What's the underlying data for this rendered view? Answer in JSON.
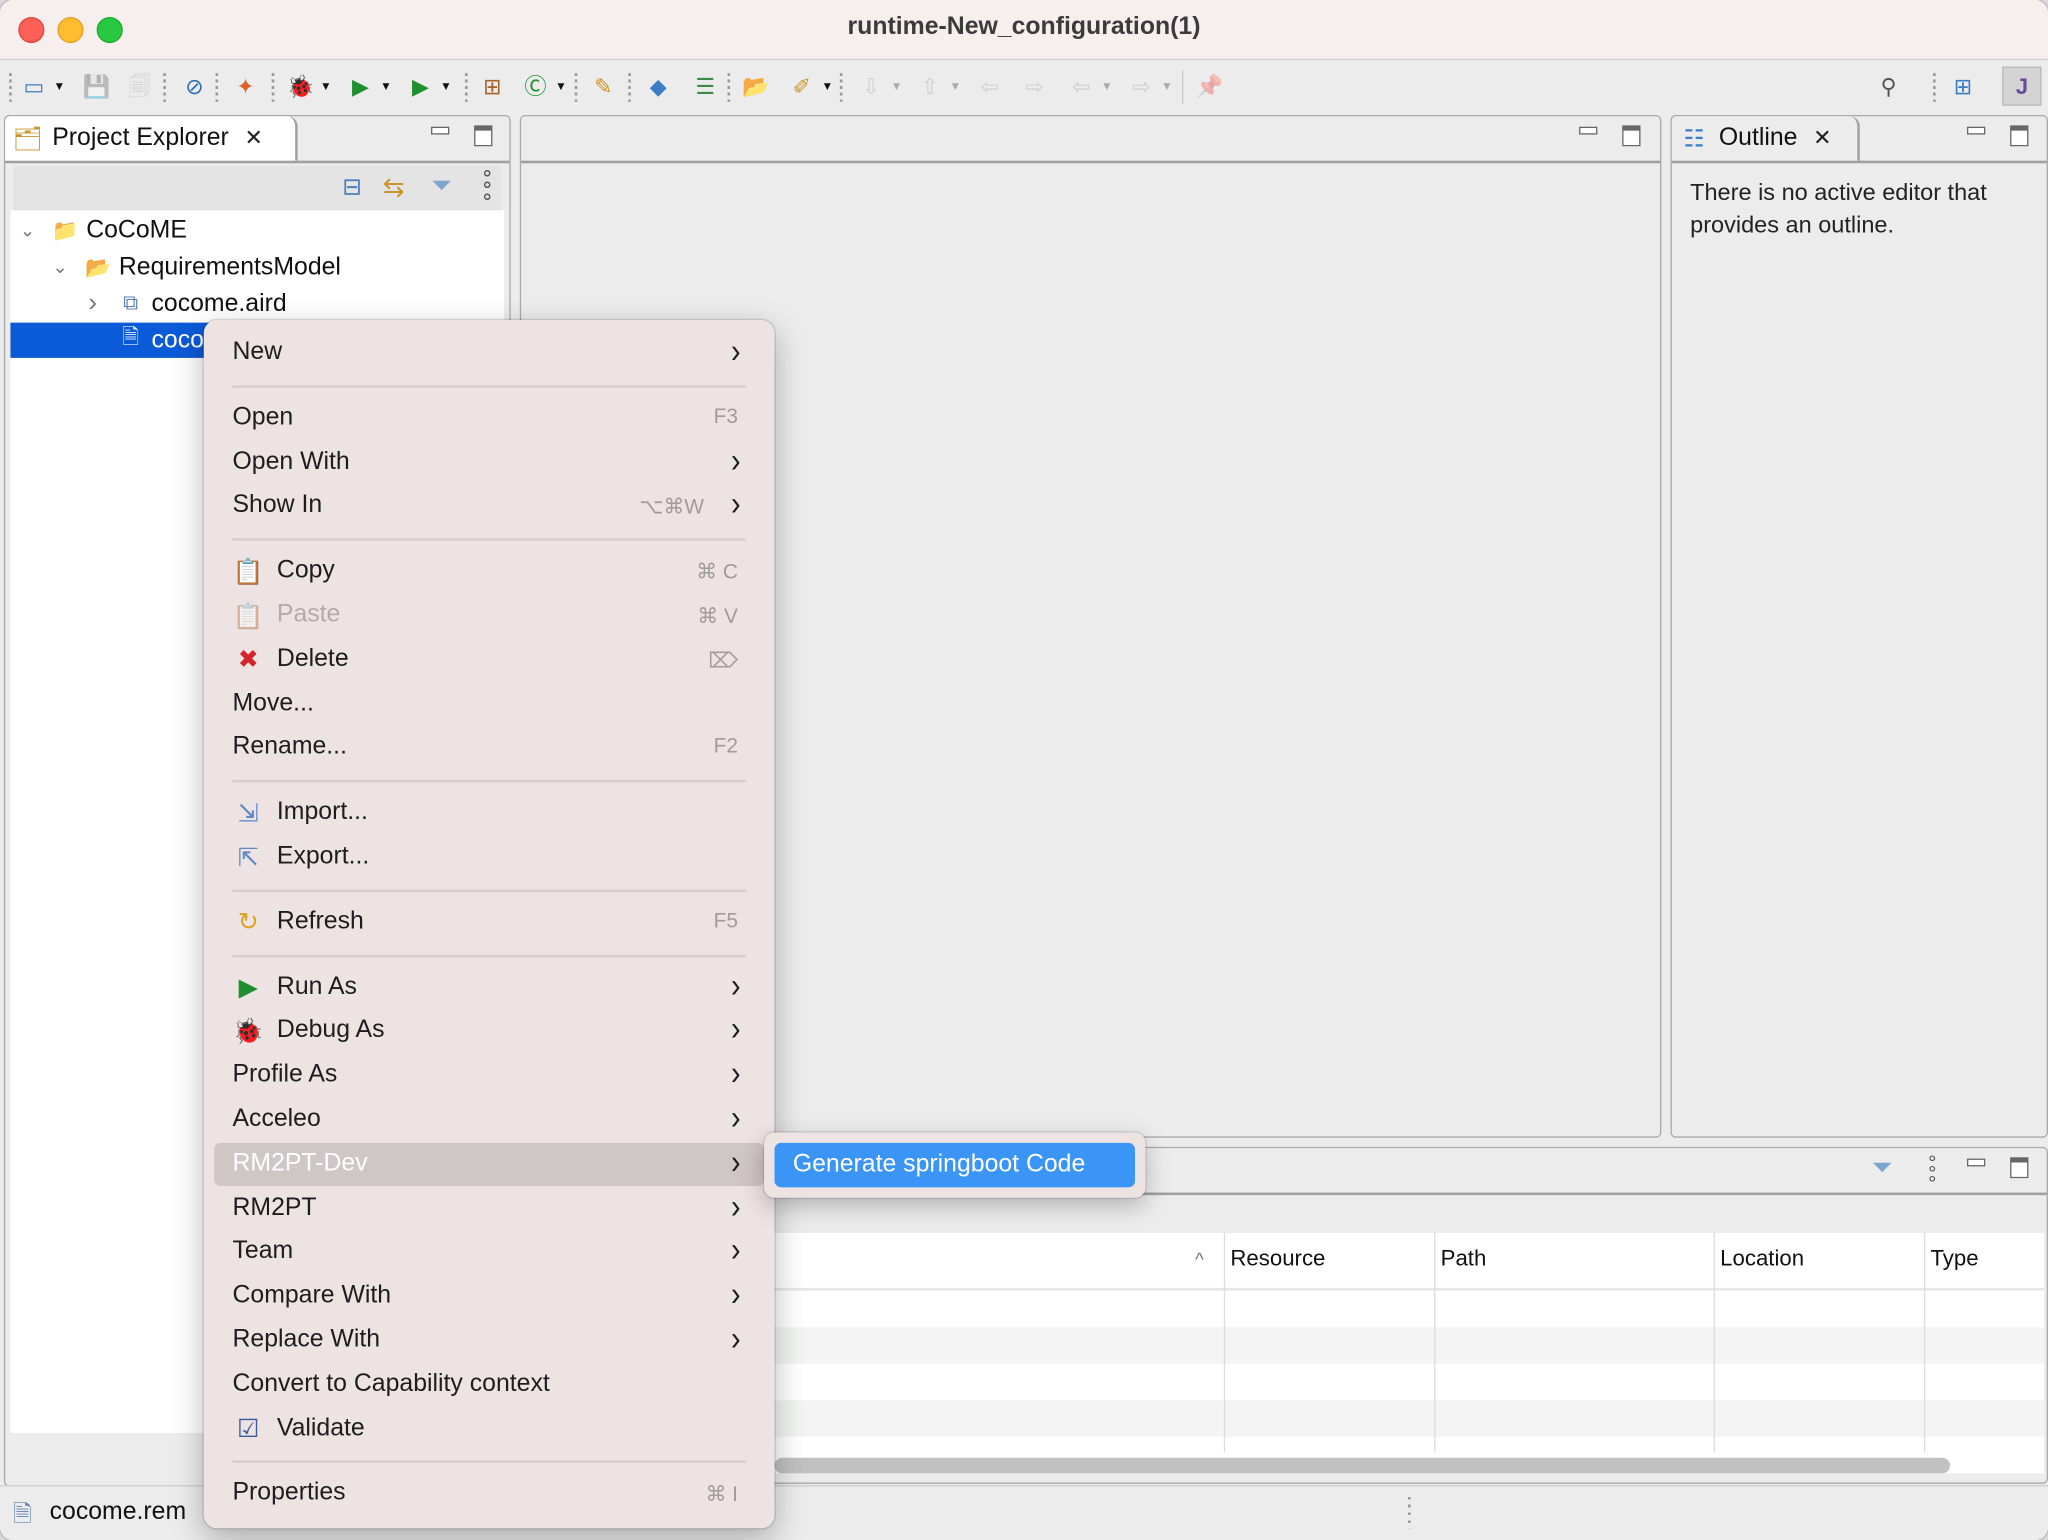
{
  "window": {
    "title": "runtime-New_configuration(1)"
  },
  "toolbar": {
    "items": [
      {
        "icon": "new-wizard-icon",
        "glyph": "▭",
        "dropdown": true,
        "disabled": false
      },
      {
        "icon": "save-icon",
        "glyph": "💾",
        "dropdown": false,
        "disabled": true
      },
      {
        "icon": "save-all-icon",
        "glyph": "🗐",
        "dropdown": false,
        "disabled": true
      },
      {
        "icon": "skip-breakpoints-icon",
        "glyph": "⊘",
        "dropdown": false,
        "disabled": false
      },
      {
        "icon": "new-model-icon",
        "glyph": "✦",
        "dropdown": false,
        "disabled": false
      },
      {
        "icon": "debug-icon",
        "glyph": "🐞",
        "dropdown": true,
        "disabled": false
      },
      {
        "icon": "run-icon",
        "glyph": "▶",
        "dropdown": true,
        "disabled": false
      },
      {
        "icon": "run-external-tools-icon",
        "glyph": "▶",
        "dropdown": true,
        "disabled": false
      },
      {
        "icon": "new-package-icon",
        "glyph": "⊞",
        "dropdown": false,
        "disabled": false
      },
      {
        "icon": "new-class-icon",
        "glyph": "Ⓒ",
        "dropdown": true,
        "disabled": false
      },
      {
        "icon": "open-task-icon",
        "glyph": "✎",
        "dropdown": false,
        "disabled": false
      },
      {
        "icon": "open-type-icon",
        "glyph": "◆",
        "dropdown": false,
        "disabled": false
      },
      {
        "icon": "open-outline-icon",
        "glyph": "☰",
        "dropdown": false,
        "disabled": false
      },
      {
        "icon": "open-folder-icon",
        "glyph": "📂",
        "dropdown": false,
        "disabled": false
      },
      {
        "icon": "annotation-pen-icon",
        "glyph": "✐",
        "dropdown": true,
        "disabled": false
      },
      {
        "icon": "next-annotation-icon",
        "glyph": "⇩",
        "dropdown": true,
        "disabled": true
      },
      {
        "icon": "previous-annotation-icon",
        "glyph": "⇧",
        "dropdown": true,
        "disabled": true
      },
      {
        "icon": "last-edit-icon",
        "glyph": "⇦",
        "dropdown": false,
        "disabled": true
      },
      {
        "icon": "next-edit-icon",
        "glyph": "⇨",
        "dropdown": false,
        "disabled": true
      },
      {
        "icon": "back-icon",
        "glyph": "⇦",
        "dropdown": true,
        "disabled": true
      },
      {
        "icon": "forward-icon",
        "glyph": "⇨",
        "dropdown": true,
        "disabled": true
      },
      {
        "icon": "pin-editor-icon",
        "glyph": "📌",
        "dropdown": false,
        "disabled": true
      }
    ],
    "right": [
      {
        "icon": "search-icon",
        "glyph": "⚲"
      },
      {
        "icon": "open-perspective-icon",
        "glyph": "⊞"
      },
      {
        "icon": "java-perspective-icon",
        "glyph": "J"
      }
    ]
  },
  "project_explorer": {
    "tab_label": "Project Explorer",
    "tree": [
      {
        "label": "CoCoME",
        "level": 0,
        "expanded": true,
        "icon": "project-icon"
      },
      {
        "label": "RequirementsModel",
        "level": 1,
        "expanded": true,
        "icon": "folder-icon"
      },
      {
        "label": "cocome.aird",
        "level": 2,
        "expanded": false,
        "icon": "aird-file-icon"
      },
      {
        "label": "coco",
        "level": 2,
        "selected": true,
        "icon": "file-icon"
      }
    ],
    "status_file": "cocome.rem"
  },
  "outline": {
    "tab_label": "Outline",
    "message": "There is no active editor that provides an outline."
  },
  "context_menu": {
    "items": [
      {
        "type": "item",
        "label": "New",
        "submenu": true
      },
      {
        "type": "sep"
      },
      {
        "type": "item",
        "label": "Open",
        "shortcut": "F3"
      },
      {
        "type": "item",
        "label": "Open With",
        "submenu": true
      },
      {
        "type": "item",
        "label": "Show In",
        "shortcut": "⌥⌘W",
        "submenu": true
      },
      {
        "type": "sep"
      },
      {
        "type": "item",
        "label": "Copy",
        "shortcut": "⌘ C",
        "icon": "copy-icon",
        "glyph": "📋"
      },
      {
        "type": "item",
        "label": "Paste",
        "shortcut": "⌘ V",
        "icon": "paste-icon",
        "glyph": "📋",
        "disabled": true
      },
      {
        "type": "item",
        "label": "Delete",
        "shortcut": "⌦",
        "icon": "delete-icon",
        "glyph": "✖"
      },
      {
        "type": "item",
        "label": "Move..."
      },
      {
        "type": "item",
        "label": "Rename...",
        "shortcut": "F2"
      },
      {
        "type": "sep"
      },
      {
        "type": "item",
        "label": "Import...",
        "icon": "import-icon",
        "glyph": "⇲"
      },
      {
        "type": "item",
        "label": "Export...",
        "icon": "export-icon",
        "glyph": "⇱"
      },
      {
        "type": "sep"
      },
      {
        "type": "item",
        "label": "Refresh",
        "shortcut": "F5",
        "icon": "refresh-icon",
        "glyph": "↻"
      },
      {
        "type": "sep"
      },
      {
        "type": "item",
        "label": "Run As",
        "submenu": true,
        "icon": "run-icon",
        "glyph": "▶"
      },
      {
        "type": "item",
        "label": "Debug As",
        "submenu": true,
        "icon": "debug-icon",
        "glyph": "🐞"
      },
      {
        "type": "item",
        "label": "Profile As",
        "submenu": true
      },
      {
        "type": "item",
        "label": "Acceleo",
        "submenu": true
      },
      {
        "type": "item",
        "label": "RM2PT-Dev",
        "submenu": true,
        "highlighted": true
      },
      {
        "type": "item",
        "label": "RM2PT",
        "submenu": true
      },
      {
        "type": "item",
        "label": "Team",
        "submenu": true
      },
      {
        "type": "item",
        "label": "Compare With",
        "submenu": true
      },
      {
        "type": "item",
        "label": "Replace With",
        "submenu": true
      },
      {
        "type": "item",
        "label": "Convert to Capability context"
      },
      {
        "type": "item",
        "label": "Validate",
        "icon": "validate-checkbox-icon",
        "glyph": "☑"
      },
      {
        "type": "sep"
      },
      {
        "type": "item",
        "label": "Properties",
        "shortcut": "⌘ I"
      }
    ]
  },
  "submenu": {
    "items": [
      {
        "label": "Generate springboot Code",
        "highlighted": true
      }
    ]
  },
  "problems_view": {
    "columns": [
      "",
      "Resource",
      "Path",
      "Location",
      "Type"
    ],
    "sort_indicator": "^",
    "rows": 5
  },
  "colors": {
    "selection": "#0b5ad8",
    "submenu_highlight": "#3b95f7",
    "menu_background": "#ede3e3"
  }
}
